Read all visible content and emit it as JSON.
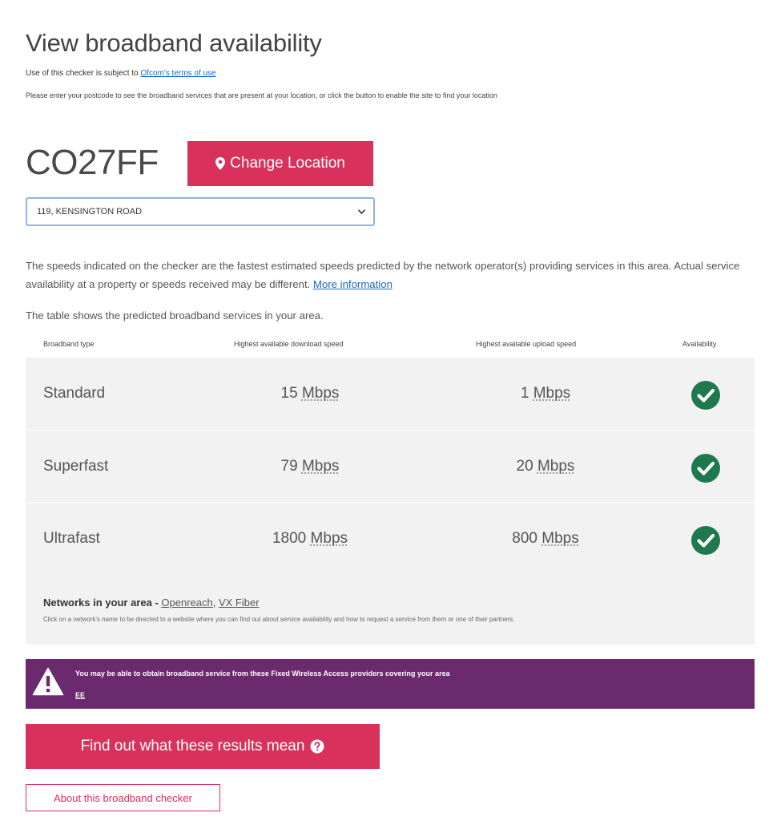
{
  "header": {
    "title": "View broadband availability",
    "terms_prefix": "Use of this checker is subject to",
    "terms_link": "Ofcom's terms of use",
    "intro": "Please enter your postcode to see the broadband services that are present at your location, or click the button to enable the site to find your location"
  },
  "location": {
    "postcode": "CO27FF",
    "change_button": "Change Location",
    "address_selected": "119, KENSINGTON ROAD"
  },
  "notes": {
    "speeds": "The speeds indicated on the checker are the fastest estimated speeds predicted by the network operator(s) providing services in this area. Actual service availability at a property or speeds received may be different.",
    "more_info_link": "More information",
    "table_intro": "The table shows the predicted broadband services in your area."
  },
  "table": {
    "headers": {
      "type": "Broadband type",
      "download": "Highest available download speed",
      "upload": "Highest available upload speed",
      "availability": "Availability"
    },
    "rows": [
      {
        "type": "Standard",
        "download": "15",
        "upload": "1",
        "unit": "Mbps",
        "available": true
      },
      {
        "type": "Superfast",
        "download": "79",
        "upload": "20",
        "unit": "Mbps",
        "available": true
      },
      {
        "type": "Ultrafast",
        "download": "1800",
        "upload": "800",
        "unit": "Mbps",
        "available": true
      }
    ],
    "networks_label": "Networks in your area -",
    "networks": [
      "Openreach",
      "VX Fiber"
    ],
    "networks_hint": "Click on a network's name to be directed to a website where you can find out about service availability and how to request a service from them or one of their partners."
  },
  "fwa_banner": {
    "message": "You may be able to obtain broadband service from these Fixed Wireless Access providers covering your area",
    "provider": "EE"
  },
  "actions": {
    "results_button": "Find out what these results mean",
    "about_button": "About this broadband checker"
  },
  "colors": {
    "accent": "#d8315b",
    "check": "#1e7a4c",
    "banner": "#6b2a6e",
    "table_bg": "#f2f2f2",
    "link": "#1a67c9"
  },
  "icons": {
    "change_location": "map-marker-icon",
    "select": "chevron-down-icon",
    "availability": "check-circle-icon",
    "banner": "warning-triangle-icon",
    "results": "question-circle-icon"
  }
}
